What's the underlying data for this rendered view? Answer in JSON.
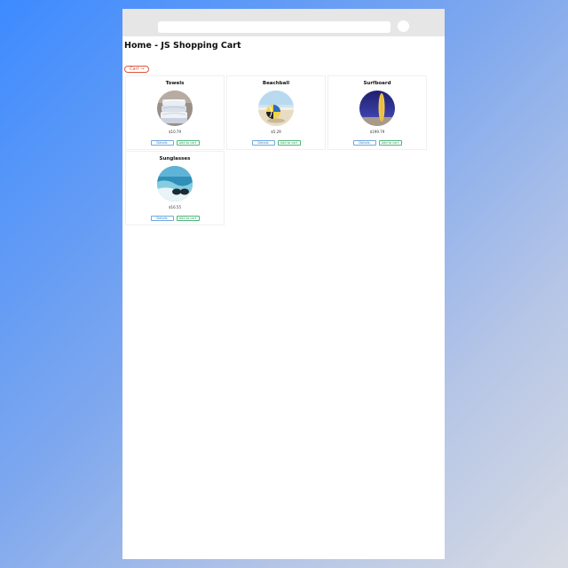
{
  "page": {
    "title": "Home - JS Shopping Cart",
    "cart_label": "Cart →"
  },
  "products": [
    {
      "name": "Towels",
      "price": "$10.79",
      "details_label": "Details",
      "add_label": "Add to cart"
    },
    {
      "name": "Beachball",
      "price": "$5.29",
      "details_label": "Details",
      "add_label": "Add to cart"
    },
    {
      "name": "Surfboard",
      "price": "$199.79",
      "details_label": "Details",
      "add_label": "Add to cart"
    },
    {
      "name": "Sunglasses",
      "price": "$16.55",
      "details_label": "Details",
      "add_label": "Add to cart"
    }
  ],
  "colors": {
    "cart_accent": "#e0563b",
    "details_accent": "#3a7cc4",
    "add_accent": "#2e9a5c"
  }
}
